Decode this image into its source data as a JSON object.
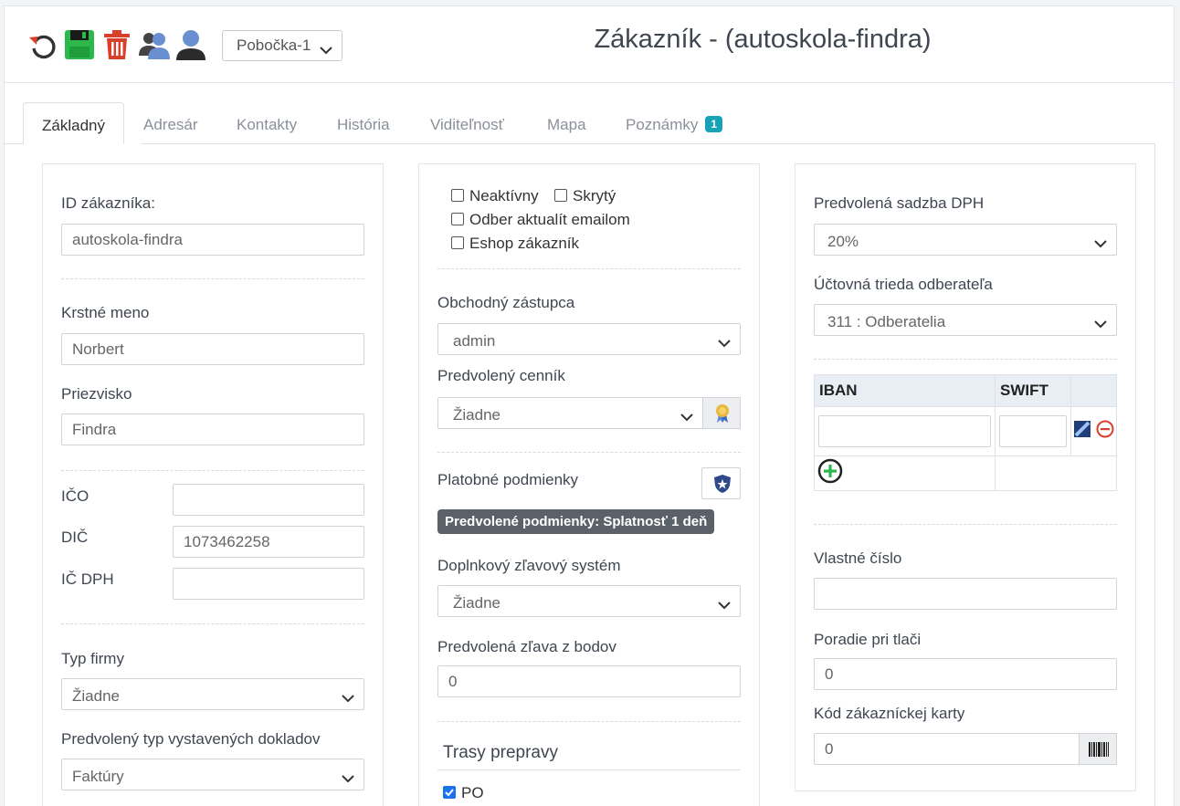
{
  "toolbar": {
    "branch_value": "Pobočka-1"
  },
  "title": "Zákazník - (autoskola-findra)",
  "tabs": [
    {
      "label": "Základný"
    },
    {
      "label": "Adresár"
    },
    {
      "label": "Kontakty"
    },
    {
      "label": "História"
    },
    {
      "label": "Viditeľnosť"
    },
    {
      "label": "Mapa"
    },
    {
      "label": "Poznámky",
      "badge": "1"
    }
  ],
  "left": {
    "customer_id_label": "ID zákazníka:",
    "customer_id_value": "autoskola-findra",
    "first_name_label": "Krstné meno",
    "first_name_value": "Norbert",
    "last_name_label": "Priezvisko",
    "last_name_value": "Findra",
    "ico_label": "IČO",
    "ico_value": "",
    "dic_label": "DIČ",
    "dic_value": "1073462258",
    "icdph_label": "IČ DPH",
    "icdph_value": "",
    "company_type_label": "Typ firmy",
    "company_type_value": "Žiadne",
    "doc_type_label": "Predvolený typ vystavených dokladov",
    "doc_type_value": "Faktúry"
  },
  "middle": {
    "inactive_label": "Neaktívny",
    "hidden_label": "Skrytý",
    "newsletter_label": "Odber aktualít emailom",
    "eshop_label": "Eshop zákazník",
    "sales_rep_label": "Obchodný zástupca",
    "sales_rep_value": "admin",
    "pricelist_label": "Predvolený cenník",
    "pricelist_value": "Žiadne",
    "payment_terms_label": "Platobné podmienky",
    "payment_terms_pill": "Predvolené podmienky: Splatnosť 1 deň",
    "discount_system_label": "Doplnkový zľavový systém",
    "discount_system_value": "Žiadne",
    "points_discount_label": "Predvolená zľava z bodov",
    "points_discount_value": "0",
    "routes_title": "Trasy prepravy",
    "route_po_label": "PO",
    "route_po_checked": true
  },
  "right": {
    "vat_label": "Predvolená sadzba DPH",
    "vat_value": "20%",
    "account_class_label": "Účtovná trieda odberateľa",
    "account_class_value": "311 : Odberatelia",
    "iban_header": "IBAN",
    "swift_header": "SWIFT",
    "own_number_label": "Vlastné číslo",
    "own_number_value": "",
    "print_order_label": "Poradie pri tlači",
    "print_order_value": "0",
    "card_code_label": "Kód zákazníckej karty",
    "card_code_value": "0"
  },
  "colors": {
    "accent_badge": "#17a2b8",
    "save_green": "#2db84b",
    "delete_red": "#d9402b",
    "pill_gray": "#5b6168"
  }
}
